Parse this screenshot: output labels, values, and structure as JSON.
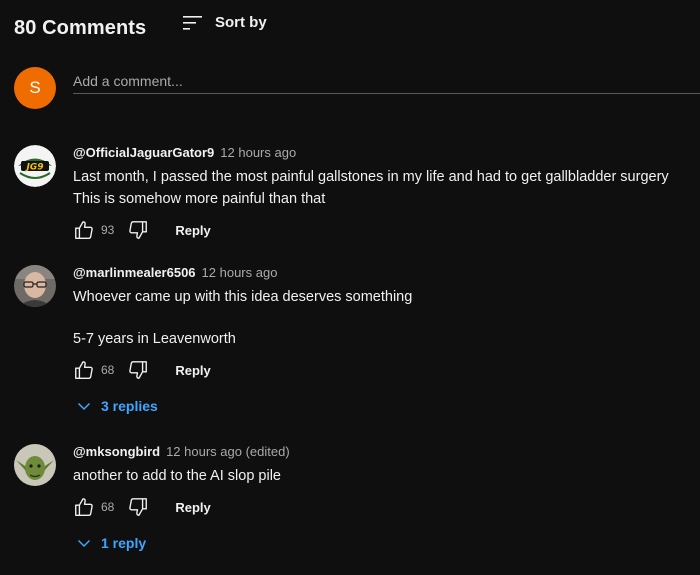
{
  "header": {
    "count": "80 Comments",
    "sort_label": "Sort by",
    "sort_icon": "sort-icon"
  },
  "add_comment": {
    "avatar_letter": "S",
    "avatar_color": "#ef6c00",
    "placeholder": "Add a comment..."
  },
  "colors": {
    "background": "#0f0f0f",
    "text": "#f1f1f1",
    "muted": "#aaaaaa",
    "link": "#3ea6ff"
  },
  "comments": [
    {
      "author": "@OfficialJaguarGator9",
      "time": "12 hours ago",
      "text_lines": [
        "Last month, I passed the most painful gallstones in my life and had to get gallbladder surgery",
        "This is somehow more painful than that"
      ],
      "likes": "93",
      "reply_label": "Reply",
      "avatar_logo_text": "JG9"
    },
    {
      "author": "@marlinmealer6506",
      "time": "12 hours ago",
      "text_lines": [
        "Whoever came up with this idea deserves something",
        "5-7 years in Leavenworth"
      ],
      "likes": "68",
      "reply_label": "Reply",
      "replies_label": "3 replies"
    },
    {
      "author": "@mksongbird",
      "time": "12 hours ago (edited)",
      "text_lines": [
        "another to add to the AI slop pile"
      ],
      "likes": "68",
      "reply_label": "Reply",
      "replies_label": "1 reply"
    }
  ]
}
